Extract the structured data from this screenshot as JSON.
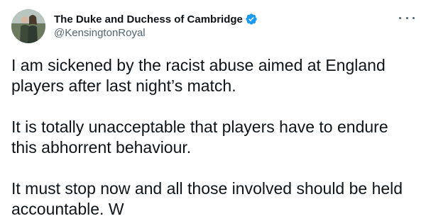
{
  "tweet": {
    "author": {
      "display_name": "The Duke and Duchess of Cambridge",
      "handle": "@KensingtonRoyal",
      "verified": true
    },
    "paragraphs": [
      "I am sickened by the racist abuse aimed at England players after last night’s match.",
      "It is totally unacceptable that players have to endure this abhorrent behaviour.",
      "It must stop now and all those involved should be held accountable. W"
    ]
  },
  "colors": {
    "text": "#0f1419",
    "secondary": "#536471",
    "verified_badge": "#1d9bf0"
  },
  "icons": {
    "more": "more-horizontal-icon",
    "verified": "verified-badge-icon"
  }
}
